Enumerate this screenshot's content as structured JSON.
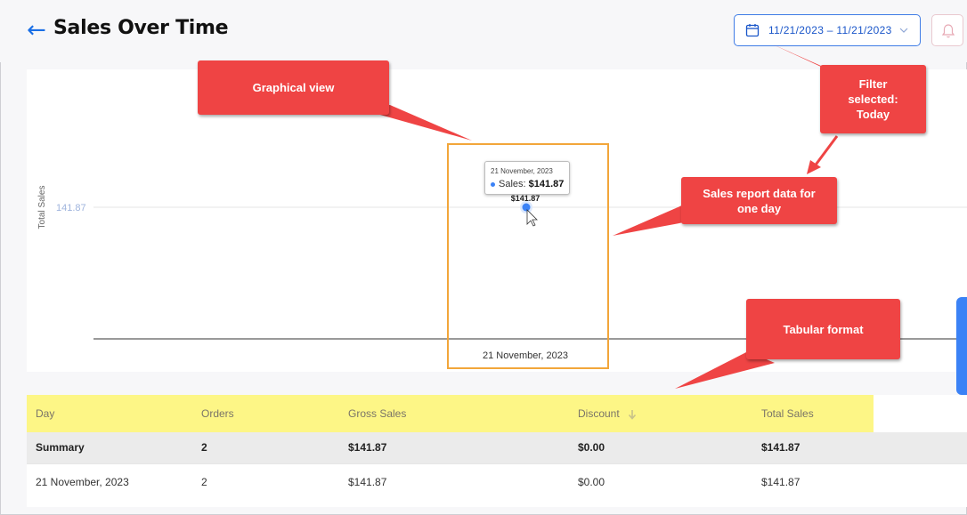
{
  "header": {
    "title": "Sales Over Time",
    "date_range": "11/21/2023 – 11/21/2023"
  },
  "chart_data": {
    "type": "line",
    "title": "",
    "xlabel": "",
    "ylabel": "Total Sales",
    "categories": [
      "21 November, 2023"
    ],
    "series": [
      {
        "name": "Sales",
        "values": [
          141.87
        ]
      }
    ],
    "y_tick_labels": [
      "141.87"
    ],
    "data_labels": [
      "$141.87"
    ],
    "ylim": [
      0,
      141.87
    ],
    "grid": true,
    "legend": "none",
    "colors": {
      "point": "#3b82f6",
      "tick_label": "#9fb4dd"
    }
  },
  "tooltip": {
    "date": "21 November, 2023",
    "series_label": "Sales: ",
    "value": "$141.87"
  },
  "table": {
    "columns": [
      "Day",
      "Orders",
      "Gross Sales",
      "Discount",
      "Total Sales"
    ],
    "summary": [
      "Summary",
      "2",
      "$141.87",
      "$0.00",
      "$141.87"
    ],
    "rows": [
      [
        "21 November, 2023",
        "2",
        "$141.87",
        "$0.00",
        "$141.87"
      ]
    ],
    "sorted_column_icon": "arrow-down-icon"
  },
  "annotations": {
    "graphical_view": "Graphical view",
    "filter_selected": "Filter selected: Today",
    "sales_report": "Sales report data for one day",
    "tabular_format": "Tabular format"
  },
  "colors": {
    "accent": "#1a6fe6",
    "callout": "#ef4444",
    "highlight_box": "#f2a63a",
    "table_header_highlight": "#fdf686"
  }
}
